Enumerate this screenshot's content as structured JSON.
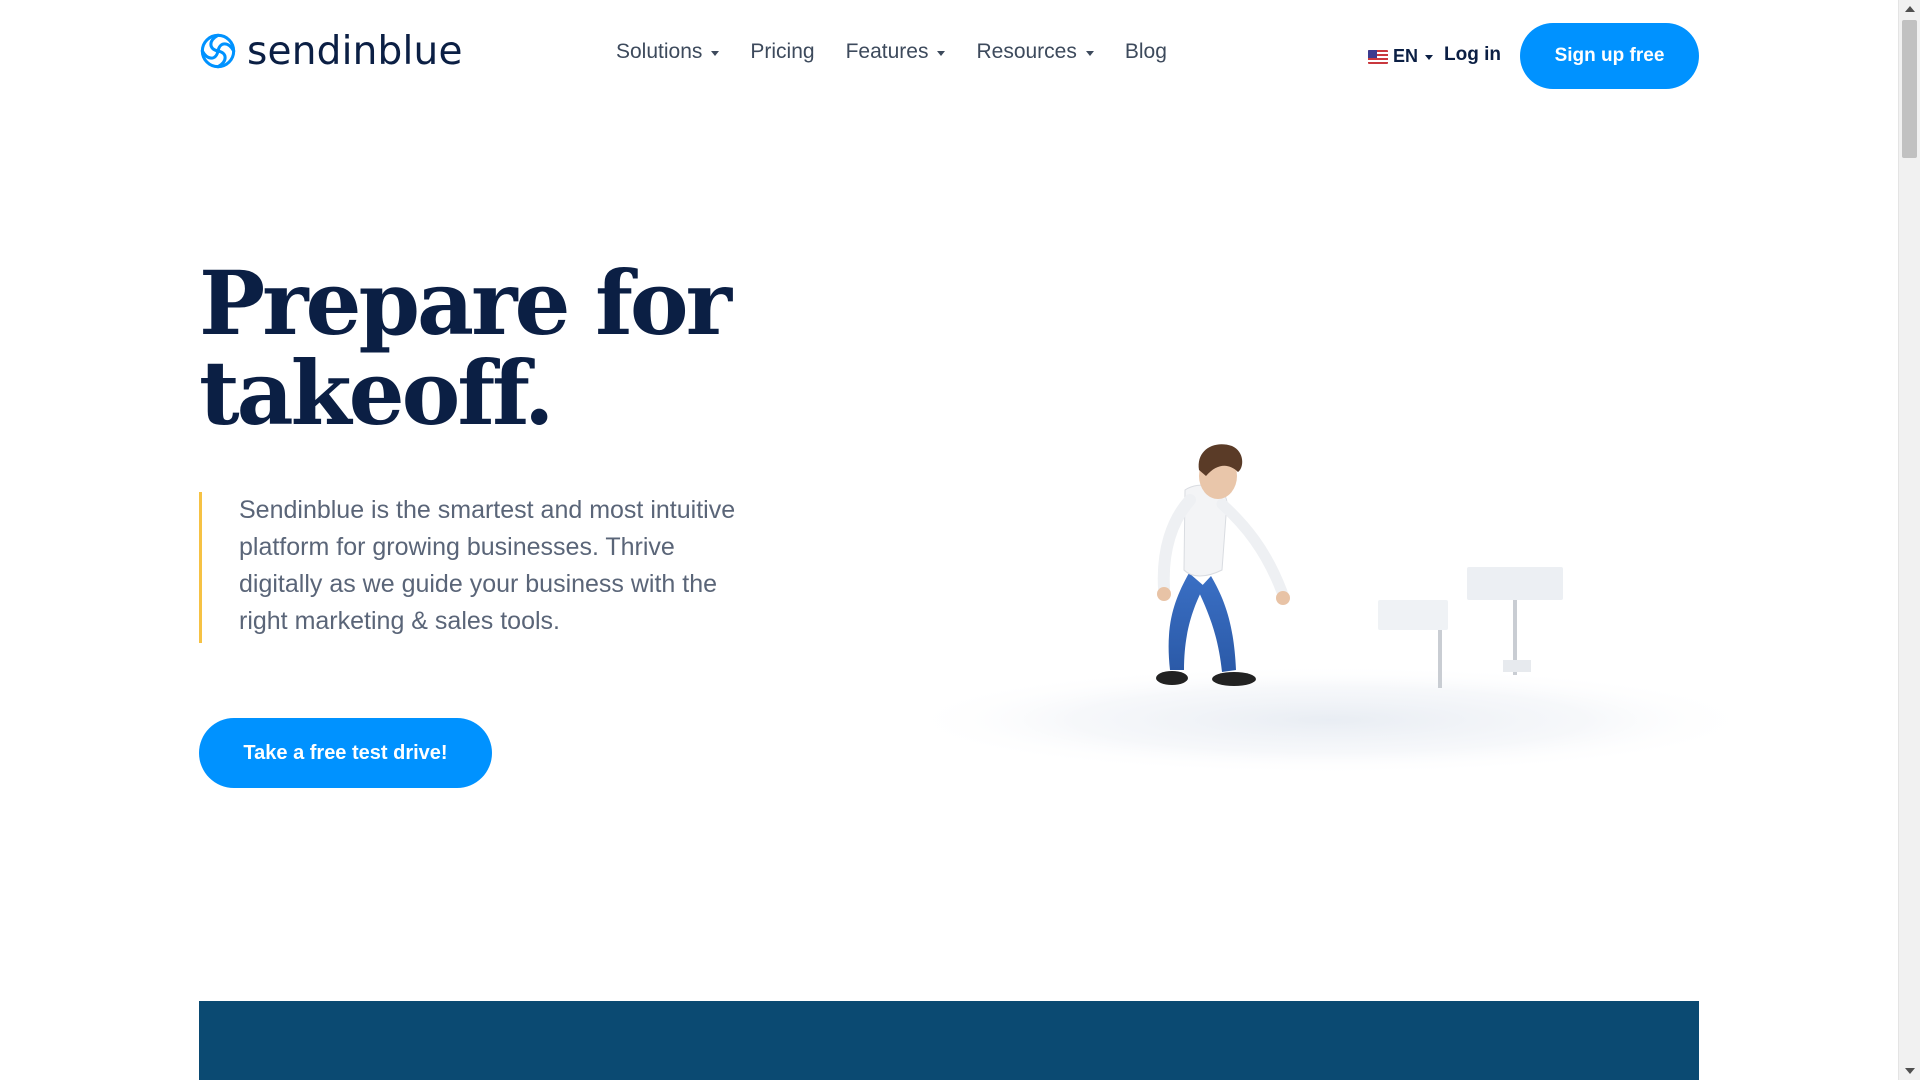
{
  "brand": {
    "name": "sendinblue",
    "logo_icon": "swirl-logo-icon",
    "accent_color": "#0092ff",
    "dark_color": "#0b1f44",
    "band_color": "#0b4a72",
    "quote_bar_color": "#f6c244"
  },
  "nav": {
    "items": [
      {
        "label": "Solutions",
        "has_dropdown": true
      },
      {
        "label": "Pricing",
        "has_dropdown": false
      },
      {
        "label": "Features",
        "has_dropdown": true
      },
      {
        "label": "Resources",
        "has_dropdown": true
      },
      {
        "label": "Blog",
        "has_dropdown": false
      }
    ]
  },
  "header": {
    "language": {
      "label": "EN",
      "flag_icon": "us-flag-icon"
    },
    "login_label": "Log in",
    "signup_label": "Sign up free"
  },
  "hero": {
    "title_line1": "Prepare for",
    "title_line2": "takeoff.",
    "description": "Sendinblue is the smartest and most intuitive platform for growing businesses. Thrive digitally as we guide your business with the right marketing & sales tools.",
    "cta_label": "Take a free test drive!"
  }
}
